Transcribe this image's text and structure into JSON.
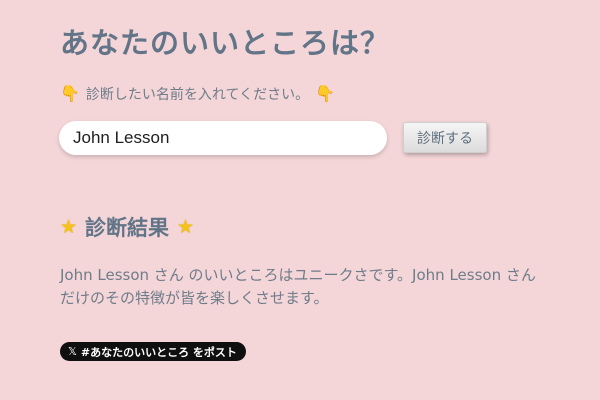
{
  "title": "あなたのいいところは？",
  "prompt": {
    "left_icon": "pointing-down-hand-icon",
    "text": "診断したい名前を入れてください。",
    "right_icon": "pointing-down-hand-icon"
  },
  "form": {
    "name_value": "John Lesson",
    "button_label": "診断する"
  },
  "result": {
    "left_icon": "star-icon",
    "heading": "診断結果",
    "right_icon": "star-icon",
    "text": "John Lesson さん のいいところはユニークさです。John Lesson さん だけのその特徴が皆を楽しくさせます。"
  },
  "share": {
    "icon": "x-logo-icon",
    "label": "#あなたのいいところ をポスト"
  },
  "colors": {
    "background": "#f4d6d8",
    "heading": "#627487",
    "body_text": "#6e7c8a",
    "share_button": "#0f0f0f"
  }
}
